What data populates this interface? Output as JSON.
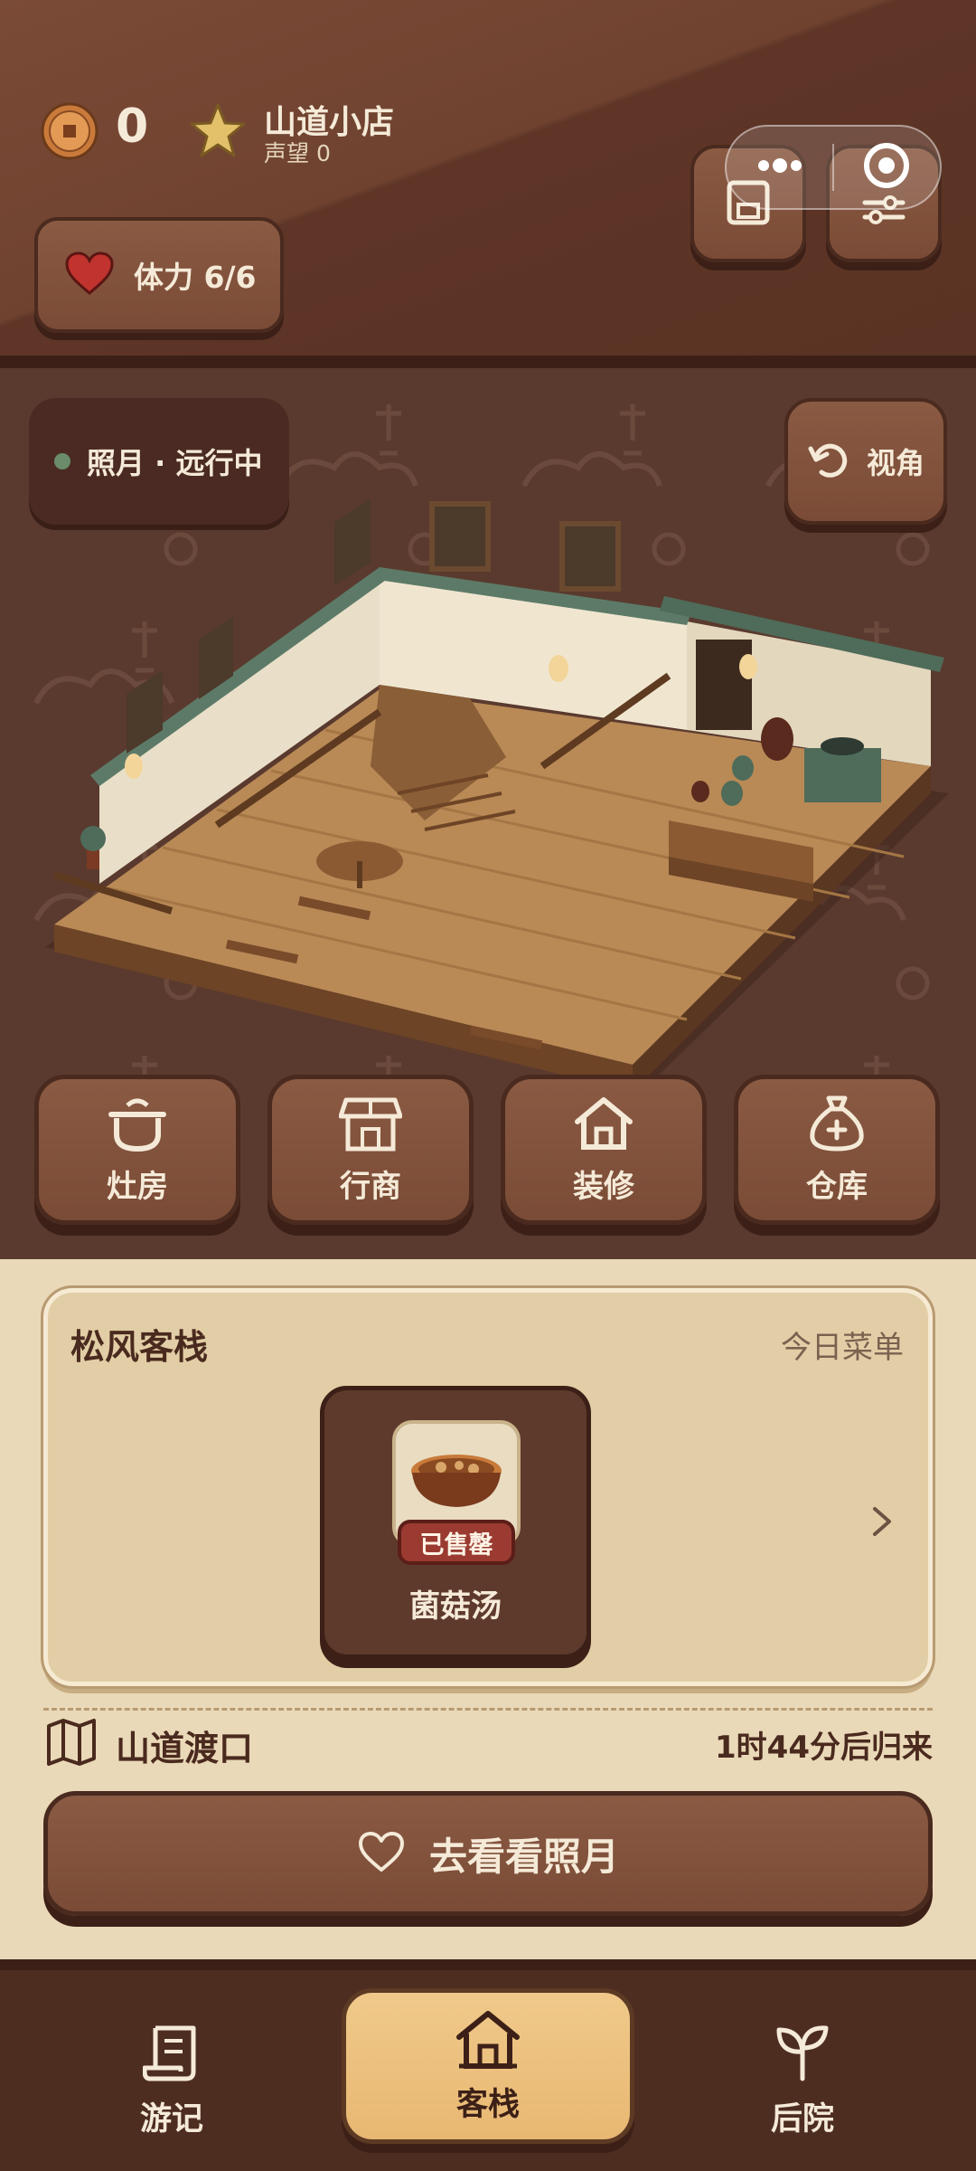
{
  "hud": {
    "coins": "0",
    "shop_name": "山道小店",
    "fame": "声望 0",
    "stamina": "体力 6/6",
    "icons": [
      "coin-icon",
      "star-icon",
      "heart-icon",
      "save-icon",
      "settings-icon",
      "more-icon",
      "target-icon"
    ]
  },
  "scene": {
    "status": "照月 · 远行中",
    "view_label": "视角",
    "actions": [
      {
        "label": "灶房",
        "icon": "pot-icon"
      },
      {
        "label": "行商",
        "icon": "shop-icon"
      },
      {
        "label": "装修",
        "icon": "home-icon"
      },
      {
        "label": "仓库",
        "icon": "bag-icon"
      }
    ]
  },
  "inn": {
    "name": "松风客栈",
    "menu_label": "今日菜单",
    "dish": {
      "name": "菌菇汤",
      "badge": "已售罄"
    },
    "location": "山道渡口",
    "return_time": "1时44分后归来",
    "visit_label": "去看看照月"
  },
  "nav": {
    "items": [
      {
        "label": "游记",
        "icon": "scroll-icon"
      },
      {
        "label": "客栈",
        "icon": "inn-icon",
        "active": true
      },
      {
        "label": "后院",
        "icon": "sprout-icon"
      }
    ]
  },
  "colors": {
    "wood_dark": "#4a2a1e",
    "wood_button": "#7a4b36",
    "cream": "#f5ead8",
    "panel": "#ead9b8",
    "active_tab": "#e8b872",
    "sold_out": "#9a3a30",
    "status_green": "#6a8c6a"
  }
}
